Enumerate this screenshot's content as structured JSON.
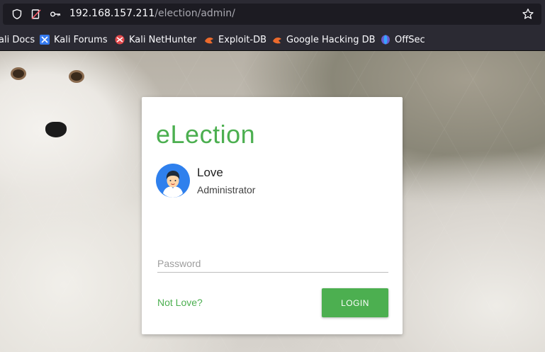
{
  "browser": {
    "url_host": "192.168.157.211",
    "url_path": "/election/admin/",
    "icons": [
      "shield-icon",
      "page-info-icon",
      "key-icon",
      "bookmark-star-icon"
    ]
  },
  "bookmarks": [
    {
      "label": "ali Docs",
      "icon": "kali-docs-icon"
    },
    {
      "label": "Kali Forums",
      "icon": "kali-forums-icon"
    },
    {
      "label": "Kali NetHunter",
      "icon": "kali-nethunter-icon"
    },
    {
      "label": "Exploit-DB",
      "icon": "exploit-db-icon"
    },
    {
      "label": "Google Hacking DB",
      "icon": "ghdb-icon"
    },
    {
      "label": "OffSec",
      "icon": "offsec-icon"
    }
  ],
  "login_card": {
    "brand": "eLection",
    "user_name": "Love",
    "user_role": "Administrator",
    "password_placeholder": "Password",
    "not_user_link": "Not Love?",
    "login_button": "LOGIN",
    "accent_color": "#4caf50"
  }
}
